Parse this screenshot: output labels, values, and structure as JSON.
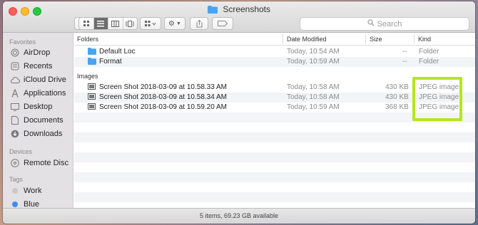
{
  "window": {
    "title": "Screenshots",
    "status": "5 items, 69.23 GB available"
  },
  "toolbar": {
    "search_placeholder": "Search"
  },
  "sidebar": {
    "favorites_heading": "Favorites",
    "favorites": [
      {
        "label": "AirDrop",
        "icon": "airdrop-icon"
      },
      {
        "label": "Recents",
        "icon": "recents-icon"
      },
      {
        "label": "iCloud Drive",
        "icon": "cloud-icon"
      },
      {
        "label": "Applications",
        "icon": "applications-icon"
      },
      {
        "label": "Desktop",
        "icon": "desktop-icon"
      },
      {
        "label": "Documents",
        "icon": "documents-icon"
      },
      {
        "label": "Downloads",
        "icon": "downloads-icon"
      }
    ],
    "devices_heading": "Devices",
    "devices": [
      {
        "label": "Remote Disc",
        "icon": "disc-icon"
      }
    ],
    "tags_heading": "Tags",
    "tags": [
      {
        "label": "Work",
        "color": "#c9c9c9"
      },
      {
        "label": "Blue",
        "color": "#3d8ef0"
      }
    ]
  },
  "columns": {
    "name": "Folders",
    "date": "Date Modified",
    "size": "Size",
    "kind": "Kind"
  },
  "groups": {
    "images": "Images"
  },
  "folders": [
    {
      "name": "Default Loc",
      "date": "Today, 10:54 AM",
      "size": "--",
      "kind": "Folder"
    },
    {
      "name": "Format",
      "date": "Today, 10:59 AM",
      "size": "--",
      "kind": "Folder"
    }
  ],
  "images": [
    {
      "name": "Screen Shot 2018-03-09 at 10.58.33 AM",
      "date": "Today, 10:58 AM",
      "size": "430 KB",
      "kind": "JPEG image"
    },
    {
      "name": "Screen Shot 2018-03-09 at 10.58.34 AM",
      "date": "Today, 10:58 AM",
      "size": "430 KB",
      "kind": "JPEG image"
    },
    {
      "name": "Screen Shot 2018-03-09 at 10.59.20 AM",
      "date": "Today, 10:59 AM",
      "size": "368 KB",
      "kind": "JPEG image"
    }
  ],
  "colors": {
    "folder_blue": "#4aa3f0",
    "highlight": "#b5e61d"
  }
}
